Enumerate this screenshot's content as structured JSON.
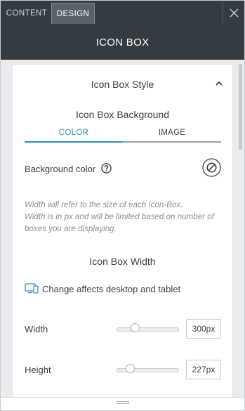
{
  "tabs": [
    {
      "label": "CONTENT",
      "active": false
    },
    {
      "label": "DESIGN",
      "active": true
    }
  ],
  "header": {
    "title": "ICON BOX"
  },
  "section": {
    "title": "Icon Box Style",
    "background": {
      "title": "Icon Box Background",
      "tabs": [
        {
          "label": "COLOR",
          "active": true
        },
        {
          "label": "IMAGE",
          "active": false
        }
      ],
      "color_label": "Background color"
    },
    "note_line1": "Width will refer to the size of each Icon-Box.",
    "note_line2": "Width is in px and will be limited based on number of boxes you are displaying.",
    "width": {
      "title": "Icon Box Width",
      "device_note": "Change affects desktop and tablet",
      "sliders": [
        {
          "label": "Width",
          "value": "300px",
          "level": 0.3
        },
        {
          "label": "Height",
          "value": "227px",
          "level": 0.22
        }
      ]
    }
  },
  "colors": {
    "dark_bar": "#343b41",
    "accent": "#2f8fbf",
    "muted_text": "#8a8f94"
  },
  "icons": {
    "close": "close-icon",
    "collapse": "chevron-up-icon",
    "help": "question-circle-icon",
    "no_color": "no-color-icon",
    "devices": "desktop-tablet-icon",
    "drag": "drag-handle-icon"
  }
}
